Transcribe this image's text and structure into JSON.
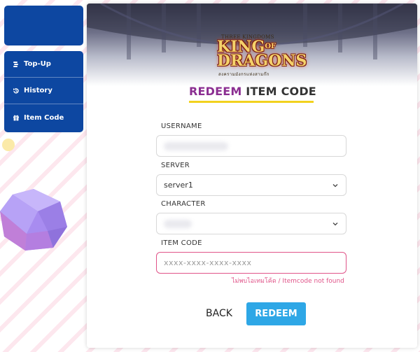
{
  "sidebar": {
    "items": [
      {
        "label": "Top-Up",
        "icon": "coins-icon"
      },
      {
        "label": "History",
        "icon": "history-icon"
      },
      {
        "label": "Item Code",
        "icon": "gift-icon"
      }
    ]
  },
  "logo": {
    "top_text": "THREE KINGDOMS",
    "main_line1": "KING",
    "main_of": "OF",
    "main_line2": "DRAGONS",
    "sub_text": "สงครามมังกรแห่งสามก๊ก"
  },
  "form": {
    "title_accent": "REDEEM",
    "title_rest": " ITEM CODE",
    "username_label": "USERNAME",
    "server_label": "SERVER",
    "server_value": "server1",
    "character_label": "CHARACTER",
    "itemcode_label": "ITEM CODE",
    "itemcode_placeholder": "xxxx-xxxx-xxxx-xxxx",
    "error_message": "ไม่พบไอเทมโค้ด / Itemcode not found",
    "back_label": "BACK",
    "redeem_label": "REDEEM"
  },
  "colors": {
    "sidebar_bg": "#0d47a1",
    "title_accent": "#8b2e91",
    "underline": "#f2d21f",
    "error": "#e05489",
    "redeem_button": "#2ea7e6"
  }
}
